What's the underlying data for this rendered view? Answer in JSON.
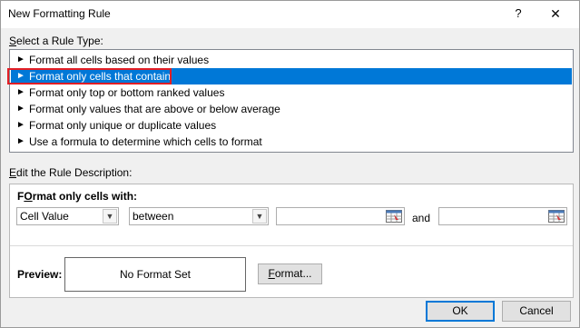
{
  "window": {
    "title": "New Formatting Rule",
    "help_label": "?",
    "close_label": "✕"
  },
  "rule_type": {
    "label_access": "S",
    "label_rest": "elect a Rule Type:",
    "arrow_glyph": "►",
    "items": [
      {
        "label": "Format all cells based on their values",
        "selected": false
      },
      {
        "label": "Format only cells that contain",
        "selected": true
      },
      {
        "label": "Format only top or bottom ranked values",
        "selected": false
      },
      {
        "label": "Format only values that are above or below average",
        "selected": false
      },
      {
        "label": "Format only unique or duplicate values",
        "selected": false
      },
      {
        "label": "Use a formula to determine which cells to format",
        "selected": false
      }
    ]
  },
  "description": {
    "label_access": "E",
    "label_rest": "dit the Rule Description:",
    "format_only_access": "O",
    "format_only_pre": "F",
    "format_only_rest": "rmat only cells with:",
    "condition_type": "Cell Value",
    "operator": "between",
    "value1": "",
    "value2": "",
    "and_label": "and",
    "dropdown_glyph": "▼",
    "preview_label": "Preview:",
    "preview_text": "No Format Set",
    "format_button_access": "F",
    "format_button_rest": "ormat..."
  },
  "buttons": {
    "ok": "OK",
    "cancel": "Cancel"
  },
  "colors": {
    "selection": "#0078d7",
    "highlight_border": "#e21e25"
  }
}
